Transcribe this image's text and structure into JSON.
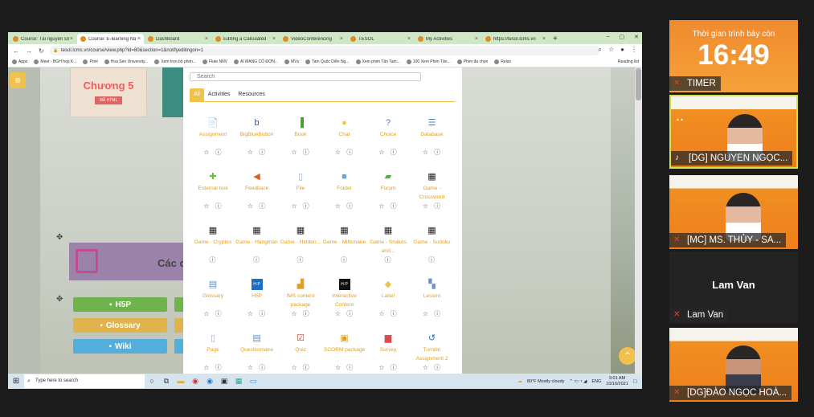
{
  "browser": {
    "tabs": [
      {
        "label": "Course: Tài nguyên số",
        "active": false
      },
      {
        "label": "Course: E-learning Nâ",
        "active": true
      },
      {
        "label": "Dashboard",
        "active": false
      },
      {
        "label": "Editing a Calculated",
        "active": false
      },
      {
        "label": "VideoConferencing",
        "active": false
      },
      {
        "label": "TESOL",
        "active": false
      },
      {
        "label": "My Activities",
        "active": false
      },
      {
        "label": "https://tesol.lcms.vn",
        "active": false
      }
    ],
    "new_tab": "+",
    "url": "tesol.lcms.vn/course/view.php?id=80&section=1&notifyeditingon=1",
    "bookmarks": [
      "Apps",
      "Meet - BGH họp K...",
      "Print",
      "Hoa Sen University...",
      "Xem trọn bộ phim...",
      "Flute NNV",
      "AI MANG CÓ ĐƠN...",
      "MVs",
      "Tam Quốc Diễn Ng...",
      "Xem phim Tân Tam...",
      "100 Xem Phim Tân...",
      "Phim đa chọn",
      "Relax"
    ],
    "reading_list": "Reading list"
  },
  "course": {
    "chapter_title": "Chương 5",
    "chapter_badge": "MÃ HTML",
    "section_title": "Các c",
    "buttons": [
      {
        "label": "H5P",
        "color": "#6fb34d"
      },
      {
        "label": "Glossary",
        "color": "#e0b34c"
      },
      {
        "label": "Wiki",
        "color": "#53aedc"
      }
    ]
  },
  "chooser": {
    "search_placeholder": "Search",
    "tabs": [
      "All",
      "Activities",
      "Resources"
    ],
    "active_tab": "All",
    "modules": [
      {
        "label": "Assignment",
        "icon": "assignment-icon",
        "glyph": "📄",
        "color": "#9b7ad2"
      },
      {
        "label": "BigBlueButton",
        "icon": "bigbluebutton-icon",
        "glyph": "b",
        "color": "#1e5aa6"
      },
      {
        "label": "Book",
        "icon": "book-icon",
        "glyph": "▐",
        "color": "#4a9d30"
      },
      {
        "label": "Chat",
        "icon": "chat-icon",
        "glyph": "●",
        "color": "#f0c24d"
      },
      {
        "label": "Choice",
        "icon": "choice-icon",
        "glyph": "?",
        "color": "#4a7bd0"
      },
      {
        "label": "Database",
        "icon": "database-icon",
        "glyph": "☰",
        "color": "#4a7bd0"
      },
      {
        "label": "External tool",
        "icon": "external-tool-icon",
        "glyph": "✚",
        "color": "#6cbf3a"
      },
      {
        "label": "Feedback",
        "icon": "feedback-icon",
        "glyph": "◀",
        "color": "#e05d1e"
      },
      {
        "label": "File",
        "icon": "file-icon",
        "glyph": "▯",
        "color": "#8fb0e3"
      },
      {
        "label": "Folder",
        "icon": "folder-icon",
        "glyph": "■",
        "color": "#6fa0e0"
      },
      {
        "label": "Forum",
        "icon": "forum-icon",
        "glyph": "▰",
        "color": "#4ab34a"
      },
      {
        "label": "Game - Crossword",
        "icon": "crossword-icon",
        "glyph": "▦",
        "color": "#222222"
      },
      {
        "label": "Game - Cryptex",
        "icon": "cryptex-icon",
        "glyph": "▦",
        "color": "#222222"
      },
      {
        "label": "Game - Hangman",
        "icon": "hangman-icon",
        "glyph": "▦",
        "color": "#222222"
      },
      {
        "label": "Game - Hidden...",
        "icon": "hidden-picture-icon",
        "glyph": "▦",
        "color": "#222222"
      },
      {
        "label": "Game - Millionaire",
        "icon": "millionaire-icon",
        "glyph": "▦",
        "color": "#222222"
      },
      {
        "label": "Game - Snakes and...",
        "icon": "snakes-icon",
        "glyph": "▦",
        "color": "#222222"
      },
      {
        "label": "Game - Sudoku",
        "icon": "sudoku-icon",
        "glyph": "▦",
        "color": "#222222"
      },
      {
        "label": "Glossary",
        "icon": "glossary-icon",
        "glyph": "▤",
        "color": "#5d8bd6"
      },
      {
        "label": "H5P",
        "icon": "h5p-icon",
        "glyph": "H·P",
        "color": "#1e6fc4"
      },
      {
        "label": "IMS content package",
        "icon": "ims-package-icon",
        "glyph": "▟",
        "color": "#e0a021"
      },
      {
        "label": "Interactive Content",
        "icon": "interactive-content-icon",
        "glyph": "H·P",
        "color": "#111111"
      },
      {
        "label": "Label",
        "icon": "label-icon",
        "glyph": "◆",
        "color": "#f0c24d"
      },
      {
        "label": "Lesson",
        "icon": "lesson-icon",
        "glyph": "▚",
        "color": "#6d8fd4"
      },
      {
        "label": "Page",
        "icon": "page-icon",
        "glyph": "▯",
        "color": "#8fb0e3"
      },
      {
        "label": "Questionnaire",
        "icon": "questionnaire-icon",
        "glyph": "▤",
        "color": "#5d8bd6"
      },
      {
        "label": "Quiz",
        "icon": "quiz-icon",
        "glyph": "☑",
        "color": "#d8402a"
      },
      {
        "label": "SCORM package",
        "icon": "scorm-icon",
        "glyph": "▣",
        "color": "#e0a021"
      },
      {
        "label": "Survey",
        "icon": "survey-icon",
        "glyph": "▆",
        "color": "#e04a4a"
      },
      {
        "label": "Turnitin Assignment 2",
        "icon": "turnitin-icon",
        "glyph": "↺",
        "color": "#1e6fc4"
      }
    ]
  },
  "taskbar": {
    "search_placeholder": "Type here to search",
    "weather": "80°F  Mostly cloudy",
    "lang": "ENG",
    "time": "9:01 AM",
    "date": "10/16/2021"
  },
  "meeting": {
    "timer_label": "Thời gian trình bày còn",
    "timer_value": "16:49",
    "participants": [
      {
        "name": "TIMER"
      },
      {
        "name": "[DG] NGUYEN NGỌC..."
      },
      {
        "name": "[MC] MS. THỦY - SA..."
      },
      {
        "name": "Lam Van"
      },
      {
        "name": "[DG]ĐÀO NGỌC HOÀ..."
      }
    ],
    "lamvan_display": "Lam Van"
  }
}
